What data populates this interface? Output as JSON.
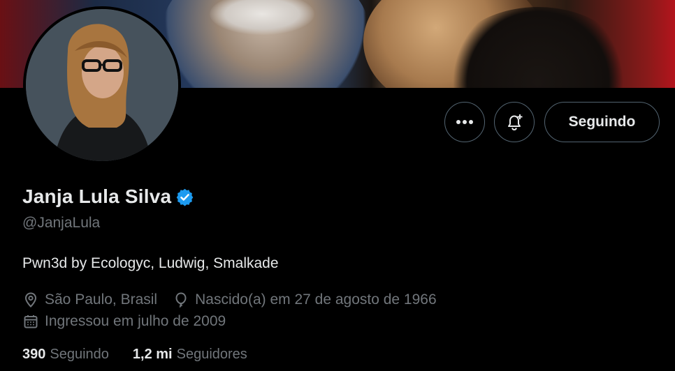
{
  "profile": {
    "name": "Janja Lula Silva",
    "handle": "@JanjaLula",
    "bio": "Pwn3d by Ecologyc, Ludwig, Smalkade",
    "location": "São Paulo, Brasil",
    "birth": "Nascido(a) em 27 de agosto de 1966",
    "joined": "Ingressou em julho de 2009",
    "verified_color": "#1d9bf0"
  },
  "actions": {
    "more_icon": "more-dots-icon",
    "notify_icon": "bell-plus-icon",
    "follow_label": "Seguindo"
  },
  "stats": {
    "following_count": "390",
    "following_label": "Seguindo",
    "followers_count": "1,2 mi",
    "followers_label": "Seguidores"
  }
}
